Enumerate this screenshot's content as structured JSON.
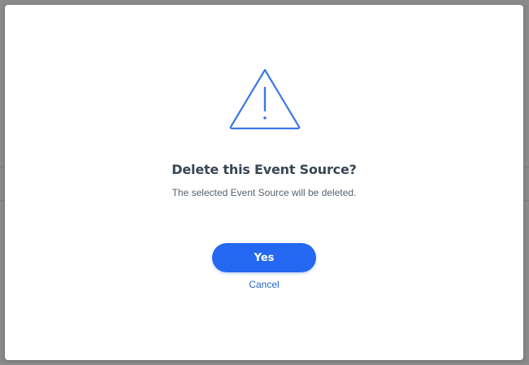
{
  "dialog": {
    "title": "Delete this Event Source?",
    "message": "The selected Event Source will be deleted.",
    "confirm_label": "Yes",
    "cancel_label": "Cancel",
    "icon": "warning-triangle-icon"
  },
  "colors": {
    "accent": "#2468f2",
    "icon_stroke": "#3b78e7",
    "title": "#3a4655",
    "message": "#58626e",
    "link": "#2563c9"
  }
}
